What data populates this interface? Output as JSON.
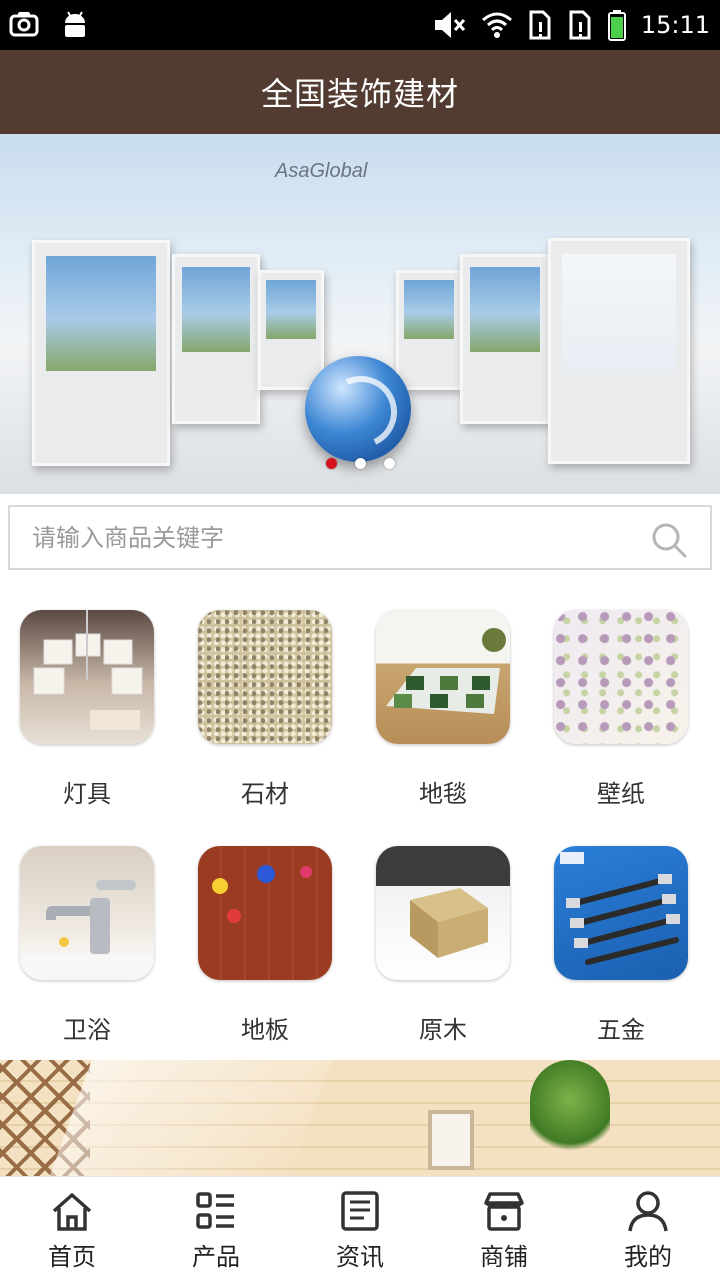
{
  "status_bar": {
    "time": "15:11",
    "icons": [
      "camera-icon",
      "android-icon",
      "mute-icon",
      "wifi-icon",
      "sim1-icon",
      "sim2-icon",
      "battery-icon"
    ]
  },
  "header": {
    "title": "全国装饰建材"
  },
  "banner": {
    "brand_text": "AsaGlobal",
    "slide_count": 3,
    "active_slide": 1,
    "active_dot_color": "#d3141c"
  },
  "search": {
    "placeholder": "请输入商品关键字",
    "value": ""
  },
  "categories": [
    {
      "label": "灯具",
      "icon": "lamp-image"
    },
    {
      "label": "石材",
      "icon": "stone-image"
    },
    {
      "label": "地毯",
      "icon": "carpet-image"
    },
    {
      "label": "壁纸",
      "icon": "wallpaper-image"
    },
    {
      "label": "卫浴",
      "icon": "faucet-image"
    },
    {
      "label": "地板",
      "icon": "floor-image"
    },
    {
      "label": "原木",
      "icon": "wood-image"
    },
    {
      "label": "五金",
      "icon": "hardware-image"
    }
  ],
  "bottom_nav": [
    {
      "label": "首页",
      "icon": "home-icon"
    },
    {
      "label": "产品",
      "icon": "grid-list-icon"
    },
    {
      "label": "资讯",
      "icon": "news-icon"
    },
    {
      "label": "商铺",
      "icon": "store-icon"
    },
    {
      "label": "我的",
      "icon": "user-icon"
    }
  ],
  "colors": {
    "header_bg": "#523c32",
    "accent": "#d3141c"
  }
}
